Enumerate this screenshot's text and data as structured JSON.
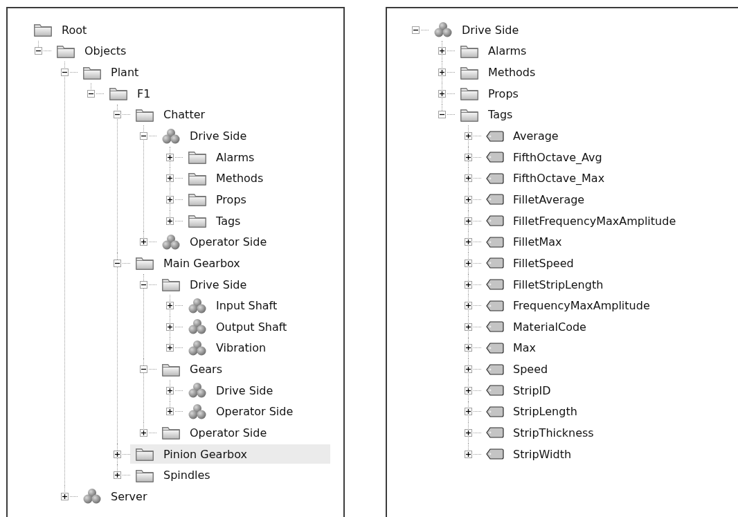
{
  "panels": [
    {
      "nodes": [
        {
          "label": "Root",
          "kind": "folder",
          "selected": false,
          "children": [
            {
              "label": "Objects",
              "kind": "folder",
              "expanded": true,
              "selected": false,
              "children": [
                {
                  "label": "Plant",
                  "kind": "folder",
                  "expanded": true,
                  "selected": false,
                  "children": [
                    {
                      "label": "F1",
                      "kind": "folder",
                      "expanded": true,
                      "selected": false,
                      "children": [
                        {
                          "label": "Chatter",
                          "kind": "folder",
                          "expanded": true,
                          "selected": false,
                          "children": [
                            {
                              "label": "Drive Side",
                              "kind": "object",
                              "expanded": true,
                              "selected": false,
                              "children": [
                                {
                                  "label": "Alarms",
                                  "kind": "folder",
                                  "expanded": false,
                                  "selected": false
                                },
                                {
                                  "label": "Methods",
                                  "kind": "folder",
                                  "expanded": false,
                                  "selected": false
                                },
                                {
                                  "label": "Props",
                                  "kind": "folder",
                                  "expanded": false,
                                  "selected": false
                                },
                                {
                                  "label": "Tags",
                                  "kind": "folder",
                                  "expanded": false,
                                  "selected": false
                                }
                              ]
                            },
                            {
                              "label": "Operator Side",
                              "kind": "object",
                              "expanded": false,
                              "selected": false
                            }
                          ]
                        },
                        {
                          "label": "Main Gearbox",
                          "kind": "folder",
                          "expanded": true,
                          "selected": false,
                          "children": [
                            {
                              "label": "Drive Side",
                              "kind": "folder",
                              "expanded": true,
                              "selected": false,
                              "children": [
                                {
                                  "label": "Input Shaft",
                                  "kind": "object",
                                  "expanded": false,
                                  "selected": false
                                },
                                {
                                  "label": "Output Shaft",
                                  "kind": "object",
                                  "expanded": false,
                                  "selected": false
                                },
                                {
                                  "label": "Vibration",
                                  "kind": "object",
                                  "expanded": false,
                                  "selected": false
                                }
                              ]
                            },
                            {
                              "label": "Gears",
                              "kind": "folder",
                              "expanded": true,
                              "selected": false,
                              "children": [
                                {
                                  "label": "Drive Side",
                                  "kind": "object",
                                  "expanded": false,
                                  "selected": false
                                },
                                {
                                  "label": "Operator Side",
                                  "kind": "object",
                                  "expanded": false,
                                  "selected": false
                                }
                              ]
                            },
                            {
                              "label": "Operator Side",
                              "kind": "folder",
                              "expanded": false,
                              "selected": false
                            }
                          ]
                        },
                        {
                          "label": "Pinion Gearbox",
                          "kind": "folder",
                          "expanded": false,
                          "selected": true
                        },
                        {
                          "label": "Spindles",
                          "kind": "folder",
                          "expanded": false,
                          "selected": false
                        }
                      ]
                    }
                  ]
                },
                {
                  "label": "Server",
                  "kind": "object",
                  "expanded": false,
                  "selected": false
                }
              ]
            }
          ]
        }
      ]
    },
    {
      "nodes": [
        {
          "label": "Drive Side",
          "kind": "object",
          "expanded": true,
          "selected": false,
          "children": [
            {
              "label": "Alarms",
              "kind": "folder",
              "expanded": false,
              "selected": false
            },
            {
              "label": "Methods",
              "kind": "folder",
              "expanded": false,
              "selected": false
            },
            {
              "label": "Props",
              "kind": "folder",
              "expanded": false,
              "selected": false
            },
            {
              "label": "Tags",
              "kind": "folder",
              "expanded": true,
              "selected": false,
              "children": [
                {
                  "label": "Average",
                  "kind": "tag",
                  "expanded": false,
                  "selected": false
                },
                {
                  "label": "FifthOctave_Avg",
                  "kind": "tag",
                  "expanded": false,
                  "selected": false
                },
                {
                  "label": "FifthOctave_Max",
                  "kind": "tag",
                  "expanded": false,
                  "selected": false
                },
                {
                  "label": "FilletAverage",
                  "kind": "tag",
                  "expanded": false,
                  "selected": false
                },
                {
                  "label": "FilletFrequencyMaxAmplitude",
                  "kind": "tag",
                  "expanded": false,
                  "selected": false
                },
                {
                  "label": "FilletMax",
                  "kind": "tag",
                  "expanded": false,
                  "selected": false
                },
                {
                  "label": "FilletSpeed",
                  "kind": "tag",
                  "expanded": false,
                  "selected": false
                },
                {
                  "label": "FilletStripLength",
                  "kind": "tag",
                  "expanded": false,
                  "selected": false
                },
                {
                  "label": "FrequencyMaxAmplitude",
                  "kind": "tag",
                  "expanded": false,
                  "selected": false
                },
                {
                  "label": "MaterialCode",
                  "kind": "tag",
                  "expanded": false,
                  "selected": false
                },
                {
                  "label": "Max",
                  "kind": "tag",
                  "expanded": false,
                  "selected": false
                },
                {
                  "label": "Speed",
                  "kind": "tag",
                  "expanded": false,
                  "selected": false
                },
                {
                  "label": "StripID",
                  "kind": "tag",
                  "expanded": false,
                  "selected": false
                },
                {
                  "label": "StripLength",
                  "kind": "tag",
                  "expanded": false,
                  "selected": false
                },
                {
                  "label": "StripThickness",
                  "kind": "tag",
                  "expanded": false,
                  "selected": false
                },
                {
                  "label": "StripWidth",
                  "kind": "tag",
                  "expanded": false,
                  "selected": false
                }
              ]
            }
          ]
        }
      ]
    }
  ]
}
